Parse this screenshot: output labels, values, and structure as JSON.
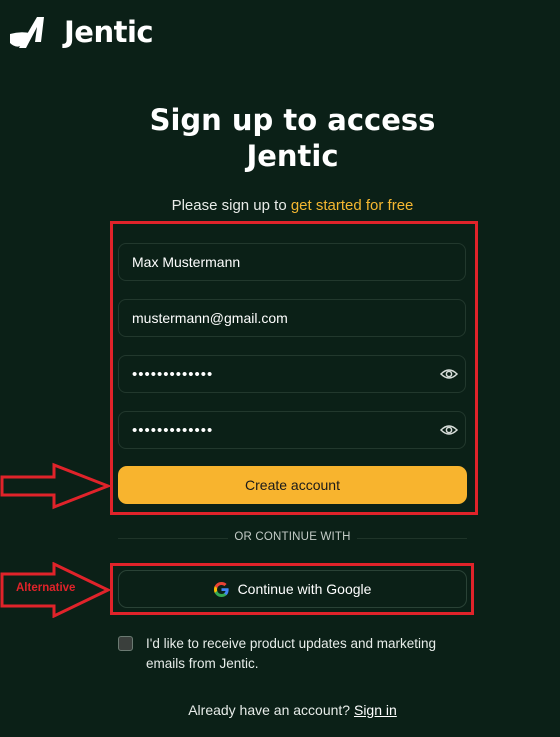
{
  "brand": {
    "name": "Jentic"
  },
  "heading": {
    "line1": "Sign up to access",
    "line2": "Jentic"
  },
  "subtitle": {
    "prefix": "Please sign up to",
    "link": "get started for free"
  },
  "form": {
    "name_value": "Max Mustermann",
    "email_value": "mustermann@gmail.com",
    "password_mask": "•••••••••••••",
    "confirm_password_mask": "•••••••••••••",
    "create_label": "Create account"
  },
  "divider_text": "OR CONTINUE WITH",
  "google": {
    "label": "Continue with Google"
  },
  "annotations": {
    "alternative_label": "Alternative",
    "color": "#e0232a"
  },
  "consent": {
    "text": "I'd like to receive product updates and marketing emails from Jentic.",
    "checked": false
  },
  "footer": {
    "prompt": "Already have an account?",
    "signin_label": "Sign in"
  },
  "colors": {
    "background": "#0b2017",
    "accent": "#f8b42e",
    "link": "#f5b731"
  }
}
